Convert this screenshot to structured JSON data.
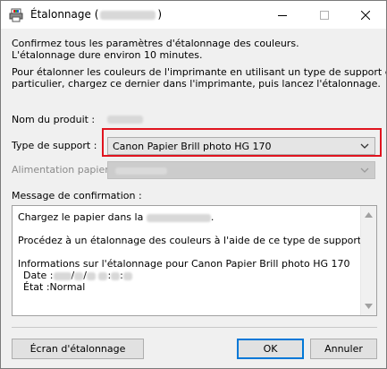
{
  "window": {
    "title": "Étalonnage (",
    "title_suffix": ")",
    "controls": {
      "minimize_icon": "minimize-icon",
      "maximize_icon": "maximize-icon",
      "close_icon": "close-icon"
    }
  },
  "intro": {
    "line1": "Confirmez tous les paramètres d'étalonnage des couleurs.",
    "line2": "L'étalonnage dure environ 10 minutes.",
    "line3": "Pour étalonner les couleurs de l'imprimante en utilisant un type de support en",
    "line4": "particulier, chargez ce dernier dans l'imprimante, puis lancez l'étalonnage."
  },
  "fields": {
    "product_label": "Nom du produit :",
    "media_label": "Type de support :",
    "media_value": "Canon Papier Brill photo HG 170",
    "feed_label": "Alimentation papier :"
  },
  "message": {
    "label": "Message de confirmation :",
    "line1_prefix": "Chargez le papier dans la",
    "line1_suffix": ".",
    "line2": "Procédez à un étalonnage des couleurs à l'aide de ce type de support.",
    "line3": "Informations sur l'étalonnage pour Canon Papier Brill photo HG 170",
    "date_label": "Date :",
    "date_sep1": "/",
    "date_sep2": "/",
    "date_sep3": ":",
    "date_sep4": ":",
    "state_label": "État :",
    "state_value": "Normal"
  },
  "buttons": {
    "calibration_screen": "Écran d'étalonnage",
    "ok": "OK",
    "cancel": "Annuler"
  },
  "colors": {
    "highlight": "#e0141f",
    "focus": "#0078d7"
  }
}
